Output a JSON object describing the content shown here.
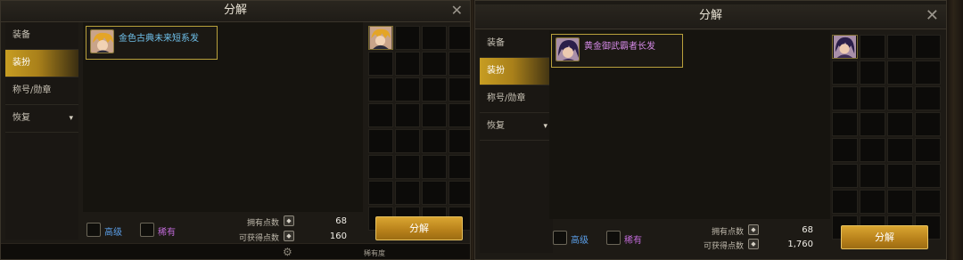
{
  "panels": [
    {
      "title": "分解",
      "close_icon": "close-icon",
      "sidebar": [
        {
          "label": "装备",
          "active": false
        },
        {
          "label": "装扮",
          "active": true
        },
        {
          "label": "称号/勋章",
          "active": false
        },
        {
          "label": "恢复",
          "active": false,
          "has_chevron": true
        }
      ],
      "item": {
        "name": "金色古典未来短系发",
        "name_color": "#e8c847",
        "hair_color": "gold"
      },
      "filters": [
        {
          "label": "高级",
          "color": "#5a9ee8"
        },
        {
          "label": "稀有",
          "color": "#c06ad8"
        }
      ],
      "points": {
        "owned_label": "拥有点数",
        "owned_value": "68",
        "obtainable_label": "可获得点数",
        "obtainable_value": "160"
      },
      "decompose_button": "分解",
      "footer_text": "稀有度"
    },
    {
      "title": "分解",
      "close_icon": "close-icon",
      "sidebar": [
        {
          "label": "装备",
          "active": false
        },
        {
          "label": "装扮",
          "active": true
        },
        {
          "label": "称号/勋章",
          "active": false
        },
        {
          "label": "恢复",
          "active": false,
          "has_chevron": true
        }
      ],
      "item": {
        "name": "黄金御武霸者长发",
        "name_color": "#d68ae8",
        "hair_color": "dark-purple"
      },
      "filters": [
        {
          "label": "高级",
          "color": "#5a9ee8"
        },
        {
          "label": "稀有",
          "color": "#c06ad8"
        }
      ],
      "points": {
        "owned_label": "拥有点数",
        "owned_value": "68",
        "obtainable_label": "可获得点数",
        "obtainable_value": "1,760"
      },
      "decompose_button": "分解"
    }
  ]
}
